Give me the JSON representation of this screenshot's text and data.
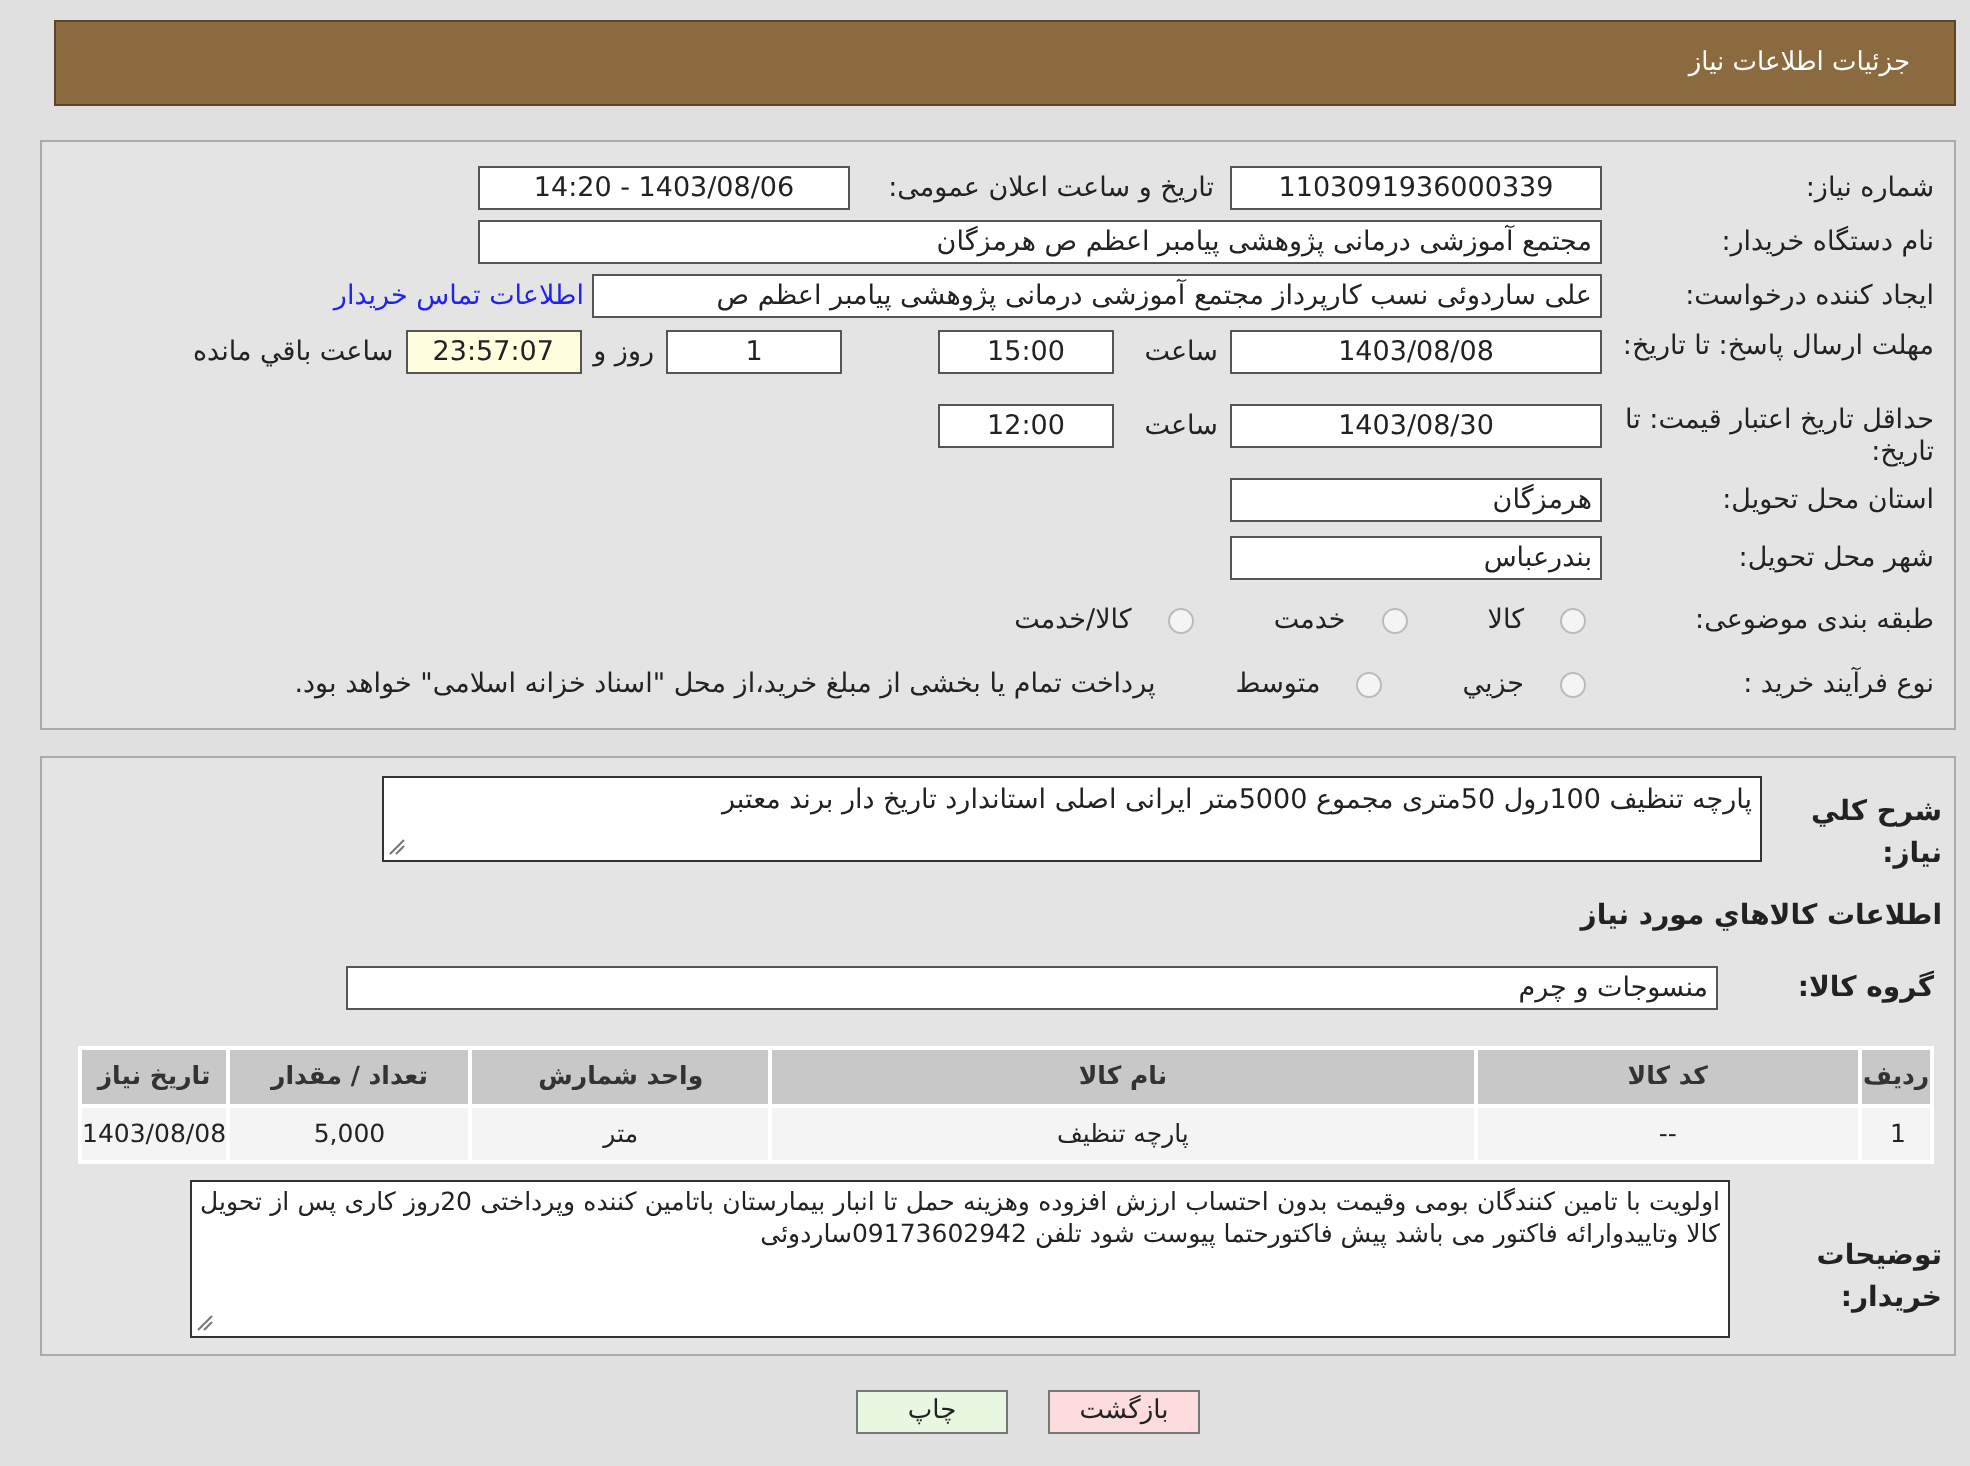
{
  "header": {
    "title": "جزئیات اطلاعات نیاز"
  },
  "need_number": {
    "label": "شماره نیاز:",
    "value": "1103091936000339"
  },
  "announce": {
    "label": "تاریخ و ساعت اعلان عمومی:",
    "value": "1403/08/06 - 14:20"
  },
  "buyer": {
    "label": "نام دستگاه خریدار:",
    "value": "مجتمع آموزشی درمانی پژوهشی پیامبر اعظم ص  هرمزگان"
  },
  "creator": {
    "label": "ایجاد کننده درخواست:",
    "value": "علی ساردوئی نسب کارپرداز مجتمع آموزشی درمانی پژوهشی پیامبر اعظم ص",
    "link": "اطلاعات تماس خریدار"
  },
  "deadline": {
    "label": "مهلت ارسال پاسخ: تا تاریخ:",
    "date": "1403/08/08",
    "time_label": "ساعت",
    "time": "15:00",
    "days": "1",
    "days_label": "روز و",
    "remaining": "23:57:07",
    "remaining_label": "ساعت باقي مانده"
  },
  "validity": {
    "label": "حداقل تاریخ اعتبار قیمت: تا تاریخ:",
    "date": "1403/08/30",
    "time_label": "ساعت",
    "time": "12:00"
  },
  "province": {
    "label": "استان محل تحویل:",
    "value": "هرمزگان"
  },
  "city": {
    "label": "شهر محل تحویل:",
    "value": "بندرعباس"
  },
  "category": {
    "label": "طبقه بندی موضوعی:",
    "options": [
      {
        "label": "کالا",
        "selected": false
      },
      {
        "label": "خدمت",
        "selected": false
      },
      {
        "label": "کالا/خدمت",
        "selected": false
      }
    ]
  },
  "process": {
    "label": "نوع فرآیند خرید :",
    "options": [
      {
        "label": "جزيي",
        "selected": false
      },
      {
        "label": "متوسط",
        "selected": false
      }
    ],
    "note": "پرداخت تمام یا بخشی از مبلغ خرید،از محل \"اسناد خزانه اسلامی\" خواهد بود."
  },
  "description": {
    "label": "شرح كلي نياز:",
    "value": "پارچه  تنظیف 100رول 50متری  مجموع 5000متر ایرانی  اصلی  استاندارد تاریخ دار  برند  معتبر"
  },
  "goods_heading": "اطلاعات كالاهاي مورد نياز",
  "goods_group": {
    "label": "گروه کالا:",
    "value": "منسوجات و چرم"
  },
  "table": {
    "columns": [
      "ردیف",
      "کد کالا",
      "نام کالا",
      "واحد شمارش",
      "تعداد / مقدار",
      "تاریخ نیاز"
    ],
    "rows": [
      [
        "1",
        "--",
        "پارچه تنظیف",
        "متر",
        "5,000",
        "1403/08/08"
      ]
    ]
  },
  "notes": {
    "label": "توضیحات خریدار:",
    "value": "اولویت با تامین کنندگان بومی وقیمت بدون احتساب ارزش افزوده وهزینه حمل تا انبار بیمارستان باتامین کننده وپرداختی 20روز کاری پس از تحویل کالا وتاییدوارائه فاکتور می باشد پیش فاکتورحتما پیوست شود تلفن 09173602942ساردوئی"
  },
  "buttons": [
    {
      "label": "بازگشت",
      "kind": "back"
    },
    {
      "label": "چاپ",
      "kind": "print"
    }
  ]
}
